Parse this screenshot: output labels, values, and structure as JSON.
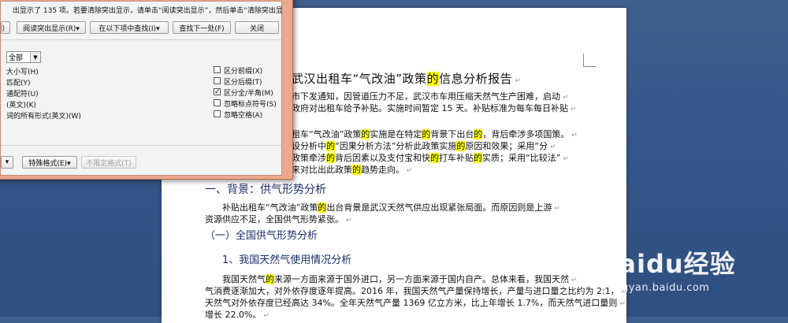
{
  "dialog": {
    "message": "出显示了 135 项。若要清除突出显示，请单击“阅读突出显示”，然后单击“清除突出显",
    "buttons": {
      "partial_left": "）",
      "reading_highlight": "阅读突出显示(R)▾",
      "find_in": "在以下项中查找(I)▾",
      "find_next": "查找下一处(F)",
      "close": "关闭",
      "partial_left2": "▾",
      "special": "特殊格式(E)▾",
      "no_format": "不限定格式(T)"
    },
    "select_value": "全部",
    "left_options": [
      "大小写(H)",
      "匹配(Y)",
      "通配符(U)",
      "(英文)(K)",
      "词的所有形式(英文)(W)"
    ],
    "right_options": [
      {
        "label": "区分前缀(X)",
        "checked": false
      },
      {
        "label": "区分后缀(T)",
        "checked": false
      },
      {
        "label": "区分全/半角(M)",
        "checked": true
      },
      {
        "label": "忽略标点符号(S)",
        "checked": false
      },
      {
        "label": "忽略空格(A)",
        "checked": false
      }
    ]
  },
  "document": {
    "title": [
      {
        "t": "武汉出租车“气改油”政策",
        "h": false
      },
      {
        "t": "的",
        "h": true
      },
      {
        "t": "信息分析报告",
        "h": false
      }
    ],
    "intro_lines": [
      [
        {
          "t": "市下发通知，因管道压力不足，武汉市车用压缩天然气生产困难，启动",
          "h": false
        }
      ],
      [
        {
          "t": "政府对出租车给予补贴。实施时间暂定 15 天。补贴标准为每车每日补贴",
          "h": false
        }
      ]
    ],
    "para2_lines": [
      [
        {
          "t": "租车“气改油”政策",
          "h": false
        },
        {
          "t": "的",
          "h": true
        },
        {
          "t": "实施是在特定",
          "h": false
        },
        {
          "t": "的",
          "h": true
        },
        {
          "t": "背景下出台",
          "h": false
        },
        {
          "t": "的",
          "h": true
        },
        {
          "t": "，背后牵涉多项国策。",
          "h": false
        }
      ],
      [
        {
          "t": "设分析中",
          "h": false
        },
        {
          "t": "的",
          "h": true
        },
        {
          "t": "“因果分析方法”分析此政策实施",
          "h": false
        },
        {
          "t": "的",
          "h": true
        },
        {
          "t": "原因和效果；采用“分",
          "h": false
        }
      ],
      [
        {
          "t": "政策牵涉",
          "h": false
        },
        {
          "t": "的",
          "h": true
        },
        {
          "t": "背后因素以及支付宝和快",
          "h": false
        },
        {
          "t": "的",
          "h": true
        },
        {
          "t": "打车补贴",
          "h": false
        },
        {
          "t": "的",
          "h": true
        },
        {
          "t": "实质；采用“比较法”",
          "h": false
        }
      ],
      [
        {
          "t": "来对比出此政策",
          "h": false
        },
        {
          "t": "的",
          "h": true
        },
        {
          "t": "趋势走向。",
          "h": false
        }
      ]
    ],
    "heading1": "一、背景：供气形势分析",
    "para3_lines": [
      [
        {
          "t": "补贴出租车“气改油”政策",
          "h": false
        },
        {
          "t": "的",
          "h": true
        },
        {
          "t": "出台背景是武汉天然气供应出现紧张局面。而原因则是上游",
          "h": false
        }
      ],
      [
        {
          "t": "资源供应不足，全国供气形势紧张。",
          "h": false
        }
      ]
    ],
    "heading2": "（一）全国供气形势分析",
    "heading3": "1、我国天然气使用情况分析",
    "para4_lines": [
      [
        {
          "t": "我国天然气",
          "h": false
        },
        {
          "t": "的",
          "h": true
        },
        {
          "t": "来源一方面来源于国外进口，另一方面来源于国内自产。总体来看，我国天然",
          "h": false
        }
      ],
      [
        {
          "t": "气消费逐渐加大，对外依存度逐年提高。2016 年，我国天然气产量保持增长，产量与进口量之比约为 2:1，",
          "h": false
        }
      ],
      [
        {
          "t": "天然气对外依存度已经高达 34%。全年天然气产量 1369 亿立方米，比上年增长 1.7%，而天然气进口量则",
          "h": false
        }
      ],
      [
        {
          "t": "增长 22.0%。",
          "h": false
        }
      ]
    ]
  },
  "watermark": {
    "logo": "Baidu经验",
    "url": "jingyan.baidu.com"
  }
}
